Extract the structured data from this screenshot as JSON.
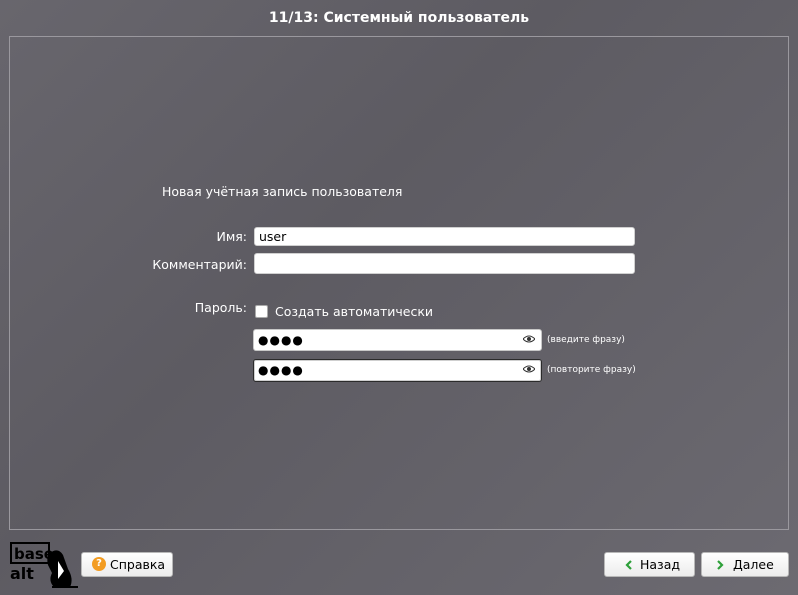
{
  "window": {
    "title": "11/13: Системный пользователь"
  },
  "form": {
    "heading": "Новая учётная запись пользователя",
    "name_label": "Имя:",
    "name_value": "user",
    "comment_label": "Комментарий:",
    "comment_value": "",
    "password_label": "Пароль:",
    "auto_label": "Создать автоматически",
    "password_value": "●●●●",
    "password_hint": "(введите фразу)",
    "password_repeat_value": "●●●●",
    "password_repeat_hint": "(повторите фразу)"
  },
  "footer": {
    "logo_text_top": "base",
    "logo_text_bottom": "alt",
    "help_label": "Справка",
    "back_label": "Назад",
    "next_label": "Далее"
  },
  "colors": {
    "help_icon": "#f39c21",
    "arrow": "#2ea03a"
  }
}
